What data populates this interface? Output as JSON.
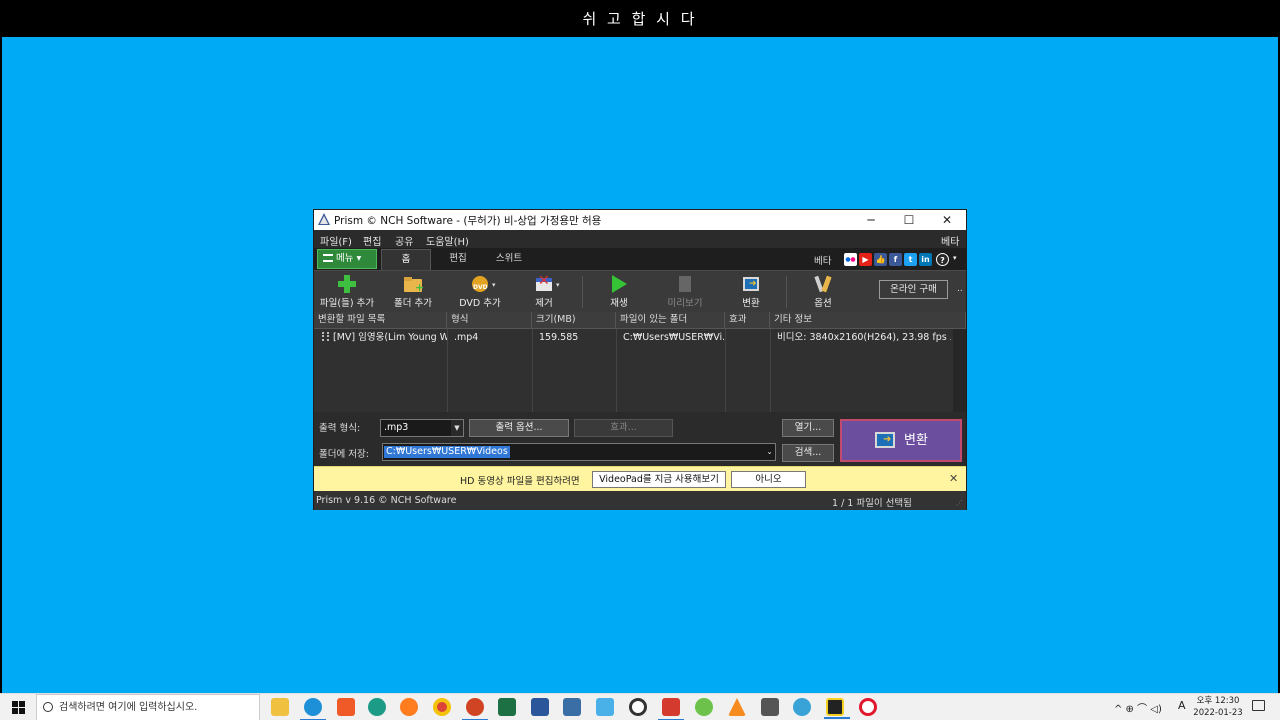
{
  "slide": {
    "title": "쉬 고 합 시 다"
  },
  "window": {
    "title": "Prism © NCH Software - (무허가) 비-상업 가정용만 허용",
    "controls": {
      "minimize": "─",
      "maximize": "☐",
      "close": "✕"
    }
  },
  "menubar": {
    "items": [
      "파일(F)",
      "편집",
      "공유",
      "도움말(H)"
    ],
    "right": "베타"
  },
  "tabs": {
    "menu_button": "메뉴",
    "items": [
      "홈",
      "편집",
      "스위트"
    ],
    "active": "홈",
    "beta": "베타"
  },
  "social_icons": [
    "flickr-icon",
    "youtube-icon",
    "thumbs-up-icon",
    "facebook-icon",
    "twitter-icon",
    "linkedin-icon",
    "help-icon"
  ],
  "toolbar": {
    "add_files": "파일(들) 추가",
    "add_folder": "폴더 추가",
    "add_dvd": "DVD 추가",
    "remove": "제거",
    "play": "재생",
    "preview": "미리보기",
    "convert": "변환",
    "options": "옵션",
    "buy_online": "온라인 구매",
    "more": ".."
  },
  "table": {
    "columns": [
      "변환할 파일 목록",
      "형식",
      "크기(MB)",
      "파일이 있는 폴더",
      "효과",
      "기타 정보"
    ],
    "rows": [
      {
        "name": "[MV] 임영웅(Lim Young W...",
        "format": ".mp4",
        "size": "159.585",
        "folder": "C:₩Users₩USER₩Vi...",
        "effect": "",
        "info": "비디오: 3840x2160(H264), 23.98 fps 오..."
      }
    ]
  },
  "controls": {
    "output_format_label": "출력 형식:",
    "output_format_value": ".mp3",
    "output_options": "출력 옵션...",
    "effects": "효과...",
    "open": "열기...",
    "save_folder_label": "폴더에 저장:",
    "save_folder_value": "C:₩Users₩USER₩Videos",
    "browse": "검색...",
    "convert": "변환"
  },
  "notification": {
    "message": "HD 동영상 파일을 편집하려면",
    "try_button": "VideoPad를 지금 사용해보기",
    "no_button": "아니오",
    "close": "✕"
  },
  "status": {
    "version": "Prism v 9.16 © NCH Software",
    "selection": "1  / 1   파일이 선택됨"
  },
  "taskbar": {
    "search_placeholder": "검색하려면 여기에 입력하십시오.",
    "tray_lang": "A",
    "time": "오후 12:30",
    "date": "2022-01-23",
    "tray_icons": "^ ⊕ ⌒ ◁)"
  },
  "colors": {
    "desktop": "#00aaf4",
    "window_bg": "#2f2f2f",
    "convert_button": "#6b4f9e",
    "notification": "#fff5a0",
    "selection": "#3178d6"
  }
}
